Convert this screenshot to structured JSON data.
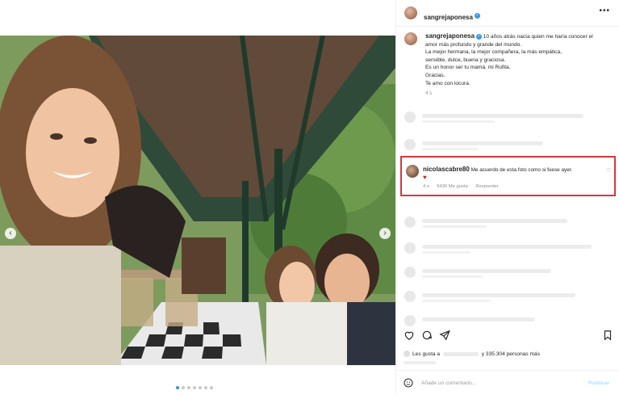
{
  "post": {
    "username": "sangrejaponesa",
    "caption_lines": [
      "10 años atrás nacía quien me haría conocer el",
      "amor más profundo y grande del mundo.",
      "La mejor hermana, la mejor compañera, la más empática,",
      "sensible, dulce, buena y graciosa.",
      "Es un honor ser tu mamá, mi Rufita.",
      "Gracias.",
      "Te amo con locura."
    ],
    "time": "4 s"
  },
  "highlighted_comment": {
    "username": "nicolascabre80",
    "text": "Me acuerdo de esta foto como si fuese ayer.",
    "emoji": "♥",
    "time": "4 s",
    "likes": "6430 Me gusta",
    "reply": "Responder"
  },
  "likes": {
    "prefix": "Les gusta a",
    "count_text": "y 335.304 personas más"
  },
  "comment_input": {
    "placeholder": "Añade un comentario...",
    "publish": "Publicar"
  },
  "icons": {
    "more": "more-icon",
    "like": "heart-icon",
    "comment": "comment-icon",
    "share": "share-icon",
    "save": "bookmark-icon",
    "emoji": "emoji-icon",
    "prev": "chevron-left-icon",
    "next": "chevron-right-icon"
  },
  "colors": {
    "highlight_border": "#d9363e",
    "verified": "#3897f0"
  }
}
